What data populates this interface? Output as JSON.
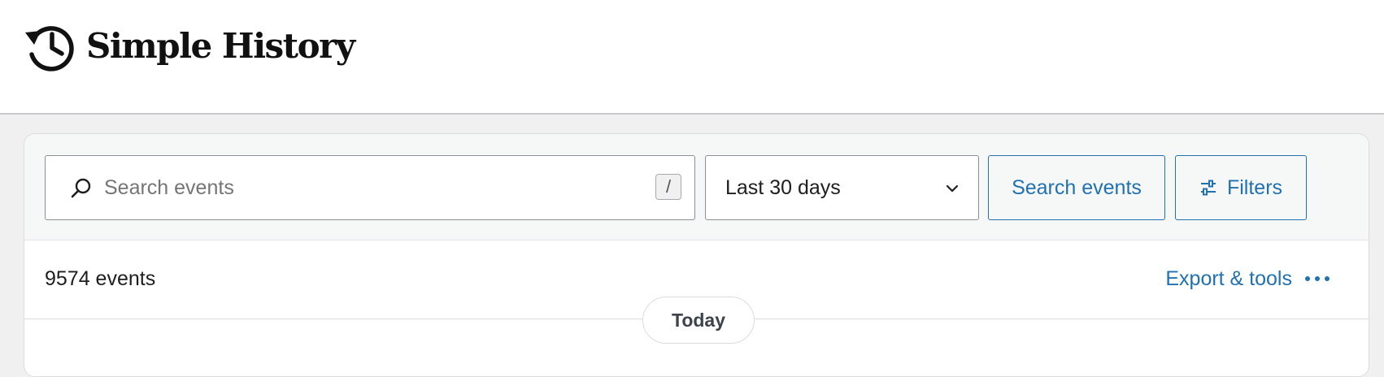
{
  "header": {
    "app_name": "Simple History",
    "logo_icon": "history-clock-icon"
  },
  "search": {
    "placeholder": "Search events",
    "value": "",
    "shortcut_hint": "/",
    "icon": "search-icon"
  },
  "date_range": {
    "selected": "Last 30 days",
    "icon": "chevron-down-icon"
  },
  "buttons": {
    "search_label": "Search events",
    "filters_label": "Filters",
    "filters_icon": "sliders-icon"
  },
  "results": {
    "count_text": "9574 events",
    "export_label": "Export & tools",
    "more_icon": "more-horizontal-icon"
  },
  "timeline": {
    "day_label": "Today"
  },
  "colors": {
    "accent": "#2271b1",
    "text": "#1e1e1e",
    "page_background": "#f0f0f1",
    "toolbar_background": "#f6f7f7"
  }
}
